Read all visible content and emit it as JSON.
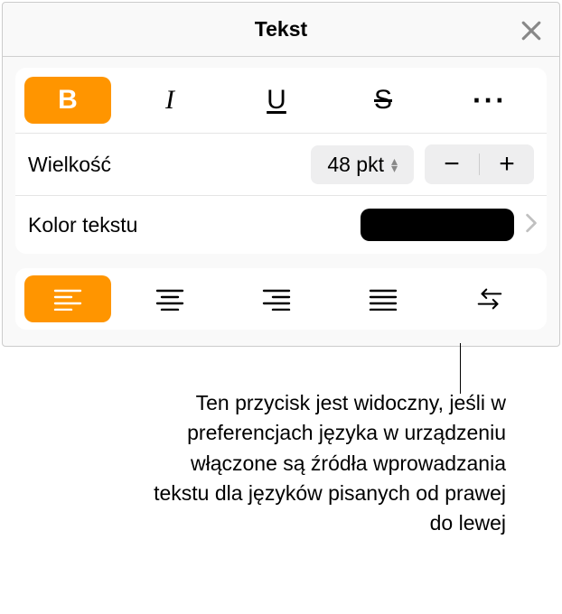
{
  "header": {
    "title": "Tekst"
  },
  "style": {
    "bold": "B",
    "italic": "I",
    "underline": "U",
    "strike": "S"
  },
  "size": {
    "label": "Wielkość",
    "value": "48 pkt",
    "minus": "−",
    "plus": "+"
  },
  "textcolor": {
    "label": "Kolor tekstu",
    "value": "#000000"
  },
  "callout": {
    "text": "Ten przycisk jest widoczny, jeśli w preferencjach języka w urządzeniu włączone są źródła wprowadzania tekstu dla języków pisanych od prawej do lewej"
  }
}
